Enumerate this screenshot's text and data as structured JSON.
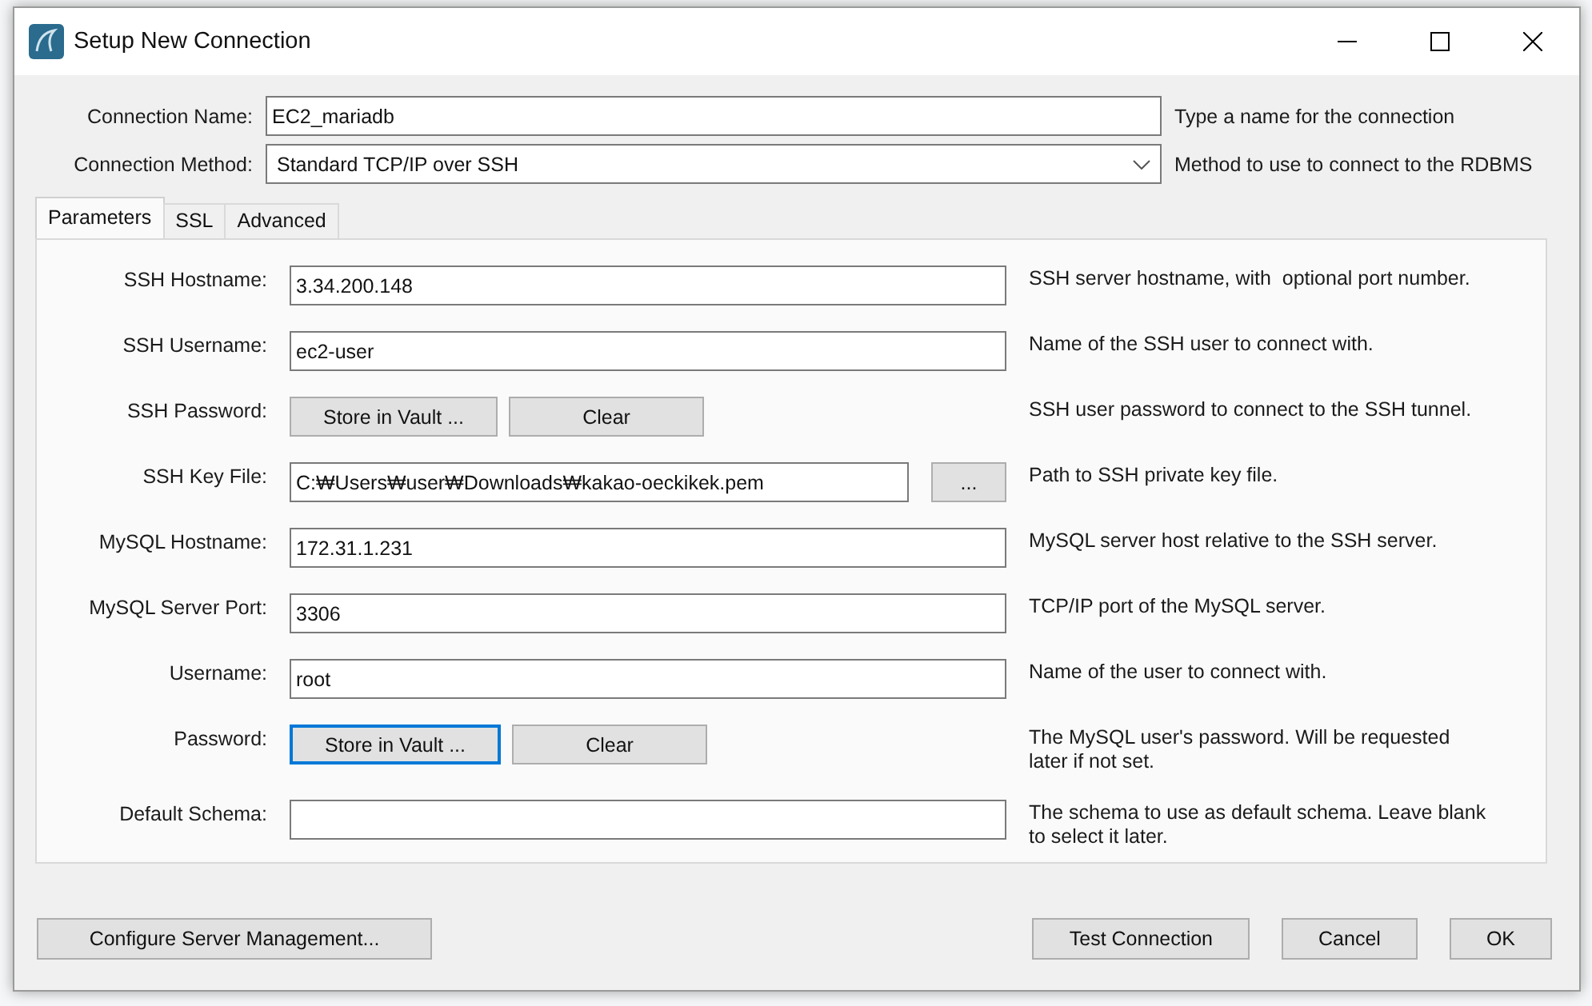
{
  "window": {
    "title": "Setup New Connection"
  },
  "header_fields": [
    {
      "kind": "text",
      "label": "Connection Name:",
      "value": "EC2_mariadb",
      "hint": "Type a name for the connection"
    },
    {
      "kind": "dropdown",
      "label": "Connection Method:",
      "value": "Standard TCP/IP over SSH",
      "hint": "Method to use to connect to the RDBMS"
    }
  ],
  "tabs": [
    {
      "label": "Parameters",
      "selected": true
    },
    {
      "label": "SSL",
      "selected": false
    },
    {
      "label": "Advanced",
      "selected": false
    }
  ],
  "parameters": [
    {
      "kind": "text",
      "label": "SSH Hostname:",
      "value": "3.34.200.148",
      "hint": "SSH server hostname, with  optional port number."
    },
    {
      "kind": "text",
      "label": "SSH Username:",
      "value": "ec2-user",
      "hint": "Name of the SSH user to connect with."
    },
    {
      "kind": "password",
      "label": "SSH Password:",
      "buttons": [
        {
          "label": "Store in Vault ...",
          "focused": false
        },
        {
          "label": "Clear",
          "focused": false
        }
      ],
      "hint": "SSH user password to connect to the SSH tunnel."
    },
    {
      "kind": "file",
      "label": "SSH Key File:",
      "value": "C:₩Users₩user₩Downloads₩kakao-oeckikek.pem",
      "browse": "...",
      "hint": "Path to SSH private key file."
    },
    {
      "kind": "text",
      "label": "MySQL Hostname:",
      "value": "172.31.1.231",
      "hint": "MySQL server host relative to the SSH server."
    },
    {
      "kind": "text",
      "label": "MySQL Server Port:",
      "value": "3306",
      "hint": "TCP/IP port of the MySQL server."
    },
    {
      "kind": "text",
      "label": "Username:",
      "value": "root",
      "hint": "Name of the user to connect with."
    },
    {
      "kind": "password",
      "label": "Password:",
      "buttons": [
        {
          "label": "Store in Vault ...",
          "focused": true
        },
        {
          "label": "Clear",
          "focused": false
        }
      ],
      "hint": "The MySQL user's password. Will be requested later if not set."
    },
    {
      "kind": "text",
      "label": "Default Schema:",
      "hint": "The schema to use as default schema. Leave blank to select it later."
    }
  ],
  "footer": {
    "left_button": "Configure Server Management...",
    "right_buttons": [
      "Test Connection",
      "Cancel",
      "OK"
    ]
  }
}
